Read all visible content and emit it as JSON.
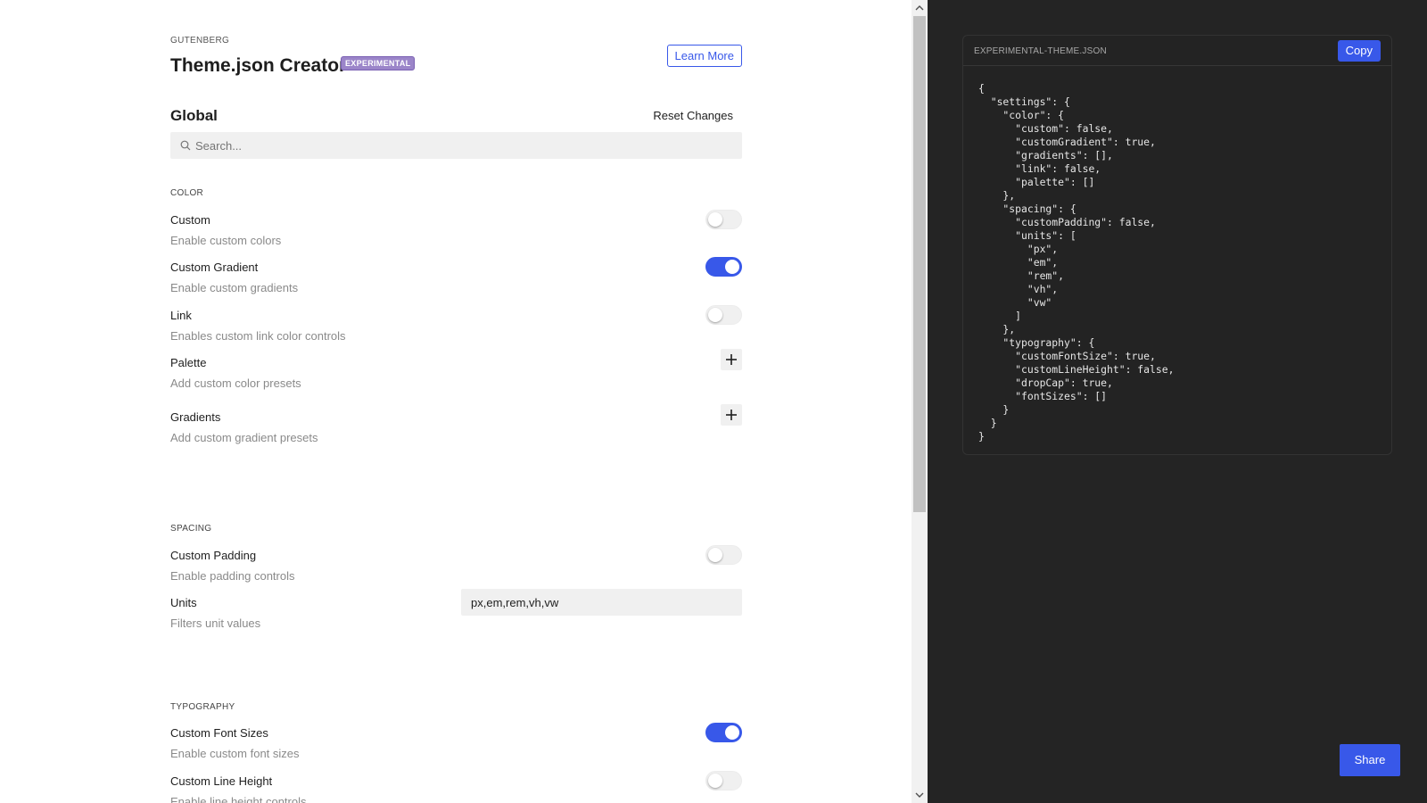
{
  "header": {
    "kicker": "GUTENBERG",
    "title": "Theme.json Creator",
    "badge": "EXPERIMENTAL",
    "learn_more": "Learn More"
  },
  "global": {
    "title": "Global",
    "reset_label": "Reset Changes",
    "search_placeholder": "Search..."
  },
  "sections": {
    "color": {
      "label": "COLOR",
      "custom": {
        "label": "Custom",
        "help": "Enable custom colors",
        "enabled": false
      },
      "custom_gradient": {
        "label": "Custom Gradient",
        "help": "Enable custom gradients",
        "enabled": true
      },
      "link": {
        "label": "Link",
        "help": "Enables custom link color controls",
        "enabled": false
      },
      "palette": {
        "label": "Palette",
        "help": "Add custom color presets"
      },
      "gradients": {
        "label": "Gradients",
        "help": "Add custom gradient presets"
      }
    },
    "spacing": {
      "label": "SPACING",
      "custom_padding": {
        "label": "Custom Padding",
        "help": "Enable padding controls",
        "enabled": false
      },
      "units": {
        "label": "Units",
        "help": "Filters unit values",
        "value": "px,em,rem,vh,vw"
      }
    },
    "typography": {
      "label": "TYPOGRAPHY",
      "custom_font_sizes": {
        "label": "Custom Font Sizes",
        "help": "Enable custom font sizes",
        "enabled": true
      },
      "custom_line_height": {
        "label": "Custom Line Height",
        "help": "Enable line height controls",
        "enabled": false
      }
    }
  },
  "code_panel": {
    "title": "EXPERIMENTAL-THEME.JSON",
    "copy_label": "Copy",
    "code": "{\n  \"settings\": {\n    \"color\": {\n      \"custom\": false,\n      \"customGradient\": true,\n      \"gradients\": [],\n      \"link\": false,\n      \"palette\": []\n    },\n    \"spacing\": {\n      \"customPadding\": false,\n      \"units\": [\n        \"px\",\n        \"em\",\n        \"rem\",\n        \"vh\",\n        \"vw\"\n      ]\n    },\n    \"typography\": {\n      \"customFontSize\": true,\n      \"customLineHeight\": false,\n      \"dropCap\": true,\n      \"fontSizes\": []\n    }\n  }\n}"
  },
  "share_label": "Share",
  "colors": {
    "accent": "#3858e9",
    "badge": "#9b85c9",
    "dark_panel": "#242424"
  },
  "icons": {
    "search": "search-icon",
    "plus": "plus-icon",
    "scroll_up": "chevron-up-icon",
    "scroll_down": "chevron-down-icon"
  }
}
